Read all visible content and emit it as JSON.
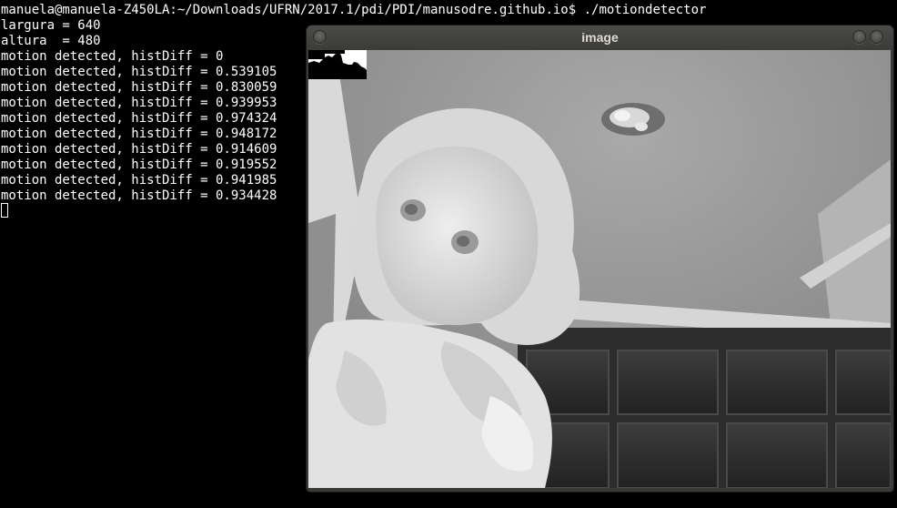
{
  "terminal": {
    "prompt": "manuela@manuela-Z450LA:~/Downloads/UFRN/2017.1/pdi/PDI/manusodre.github.io$ ./motiondetector",
    "lines": [
      "largura = 640",
      "altura  = 480",
      "motion detected, histDiff = 0",
      "motion detected, histDiff = 0.539105",
      "motion detected, histDiff = 0.830059",
      "motion detected, histDiff = 0.939953",
      "motion detected, histDiff = 0.974324",
      "motion detected, histDiff = 0.948172",
      "motion detected, histDiff = 0.914609",
      "motion detected, histDiff = 0.919552",
      "motion detected, histDiff = 0.941985",
      "motion detected, histDiff = 0.934428"
    ]
  },
  "window": {
    "title": "image",
    "icons": {
      "left": "window-menu-icon",
      "right1": "minimize-icon",
      "right2": "close-icon"
    }
  },
  "colors": {
    "terminal_bg": "#000000",
    "terminal_fg": "#ffffff",
    "titlebar": "#3c3b37",
    "title_text": "#dfdbd2"
  }
}
